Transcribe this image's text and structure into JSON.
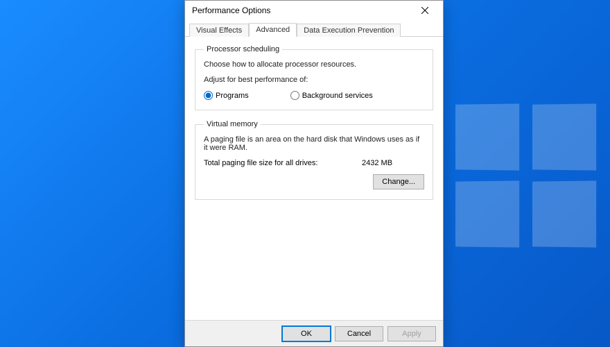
{
  "window": {
    "title": "Performance Options"
  },
  "tabs": {
    "visual_effects": "Visual Effects",
    "advanced": "Advanced",
    "dep": "Data Execution Prevention"
  },
  "processor_scheduling": {
    "legend": "Processor scheduling",
    "desc": "Choose how to allocate processor resources.",
    "adjust_label": "Adjust for best performance of:",
    "option_programs": "Programs",
    "option_background": "Background services"
  },
  "virtual_memory": {
    "legend": "Virtual memory",
    "desc": "A paging file is an area on the hard disk that Windows uses as if it were RAM.",
    "total_label": "Total paging file size for all drives:",
    "total_value": "2432 MB",
    "change_button": "Change..."
  },
  "footer": {
    "ok": "OK",
    "cancel": "Cancel",
    "apply": "Apply"
  }
}
